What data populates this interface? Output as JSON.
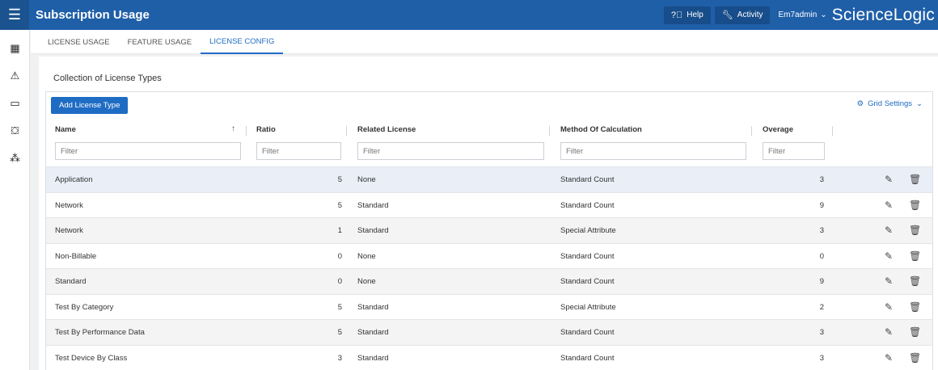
{
  "header": {
    "title": "Subscription Usage",
    "help_label": "Help",
    "activity_label": "Activity",
    "user_label": "Em7admin",
    "brand": "ScienceLogic"
  },
  "icons": {
    "menu": "hamburger-menu-icon",
    "help": "question-circle-icon",
    "activity": "wrench-icon",
    "user_menu": "chevron-down-icon",
    "sidebar": [
      "dashboard-icon",
      "alert-triangle-icon",
      "devices-icon",
      "toolbox-icon",
      "topology-icon"
    ],
    "grid_settings": "gear-icon",
    "sort": "arrow-up-icon",
    "edit": "pencil-icon",
    "delete": "trash-icon"
  },
  "tabs": [
    {
      "label": "LICENSE USAGE",
      "active": false
    },
    {
      "label": "FEATURE USAGE",
      "active": false
    },
    {
      "label": "LICENSE CONFIG",
      "active": true
    }
  ],
  "panel": {
    "title": "Collection of License Types",
    "add_button": "Add License Type",
    "grid_settings_label": "Grid Settings"
  },
  "table": {
    "columns": [
      "Name",
      "Ratio",
      "Related License",
      "Method Of Calculation",
      "Overage"
    ],
    "filter_placeholder": "Filter",
    "rows": [
      {
        "name": "Application",
        "ratio": "5",
        "related": "None",
        "method": "Standard Count",
        "overage": "3"
      },
      {
        "name": "Network",
        "ratio": "5",
        "related": "Standard",
        "method": "Standard Count",
        "overage": "9"
      },
      {
        "name": "Network",
        "ratio": "1",
        "related": "Standard",
        "method": "Special Attribute",
        "overage": "3"
      },
      {
        "name": "Non-Billable",
        "ratio": "0",
        "related": "None",
        "method": "Standard Count",
        "overage": "0"
      },
      {
        "name": "Standard",
        "ratio": "0",
        "related": "None",
        "method": "Standard Count",
        "overage": "9"
      },
      {
        "name": "Test By Category",
        "ratio": "5",
        "related": "Standard",
        "method": "Special Attribute",
        "overage": "2"
      },
      {
        "name": "Test By Performance Data",
        "ratio": "5",
        "related": "Standard",
        "method": "Standard Count",
        "overage": "3"
      },
      {
        "name": "Test Device By Class",
        "ratio": "3",
        "related": "Standard",
        "method": "Standard Count",
        "overage": "3"
      }
    ]
  },
  "colors": {
    "topbar": "#1f5fa8",
    "accent": "#1f6cc4"
  }
}
